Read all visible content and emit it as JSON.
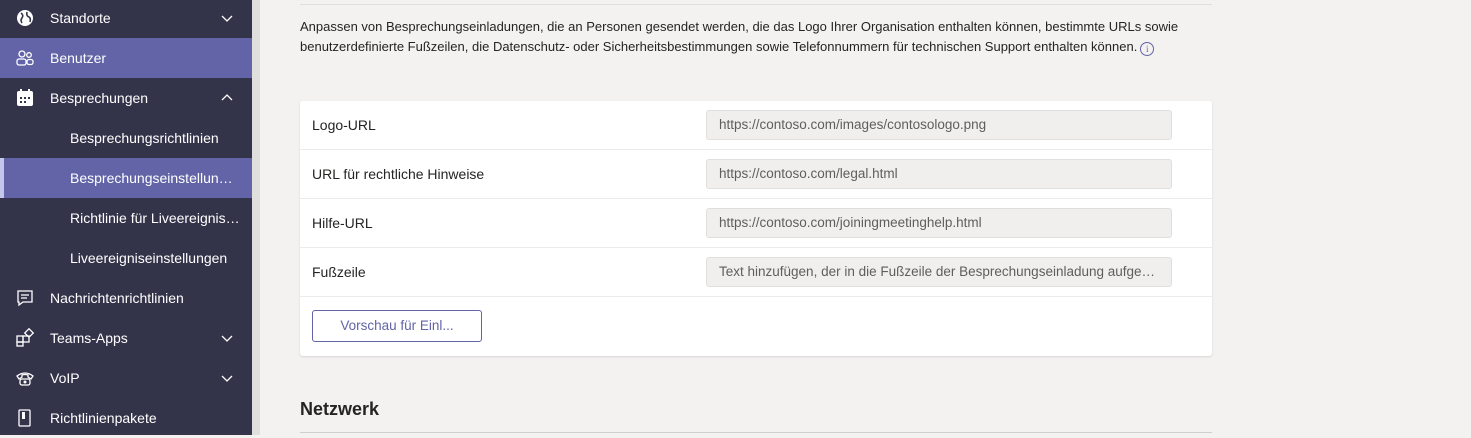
{
  "sidebar": {
    "items": [
      {
        "label": "Standorte",
        "icon": "globe-icon",
        "chevron": "down"
      },
      {
        "label": "Benutzer",
        "icon": "users-icon"
      },
      {
        "label": "Besprechungen",
        "icon": "calendar-icon",
        "chevron": "up"
      },
      {
        "label": "Besprechungsrichtlinien"
      },
      {
        "label": "Besprechungseinstellungen"
      },
      {
        "label": "Richtlinie für Liveereignisse"
      },
      {
        "label": "Liveereigniseinstellungen"
      },
      {
        "label": "Nachrichtenrichtlinien",
        "icon": "message-icon"
      },
      {
        "label": "Teams-Apps",
        "icon": "apps-icon",
        "chevron": "down"
      },
      {
        "label": "VoIP",
        "icon": "phone-icon",
        "chevron": "down"
      },
      {
        "label": "Richtlinienpakete",
        "icon": "package-icon"
      }
    ]
  },
  "main": {
    "description": "Anpassen von Besprechungseinladungen, die an Personen gesendet werden, die das Logo Ihrer Organisation enthalten können, bestimmte URLs sowie benutzerdefinierte Fußzeilen, die Datenschutz- oder Sicherheitsbestimmungen sowie Telefonnummern für technischen Support enthalten können.",
    "rows": [
      {
        "label": "Logo-URL",
        "value": "https://contoso.com/images/contosologo.png"
      },
      {
        "label": "URL für rechtliche Hinweise",
        "value": "https://contoso.com/legal.html"
      },
      {
        "label": "Hilfe-URL",
        "value": "https://contoso.com/joiningmeetinghelp.html"
      },
      {
        "label": "Fußzeile",
        "value": "Text hinzufügen, der in die Fußzeile der Besprechungseinladung aufgenommen werden soll"
      }
    ],
    "preview_button": "Vorschau für Einl...",
    "next_section_title": "Netzwerk"
  },
  "colors": {
    "sidebar_bg": "#33344a",
    "accent": "#6264a7"
  }
}
